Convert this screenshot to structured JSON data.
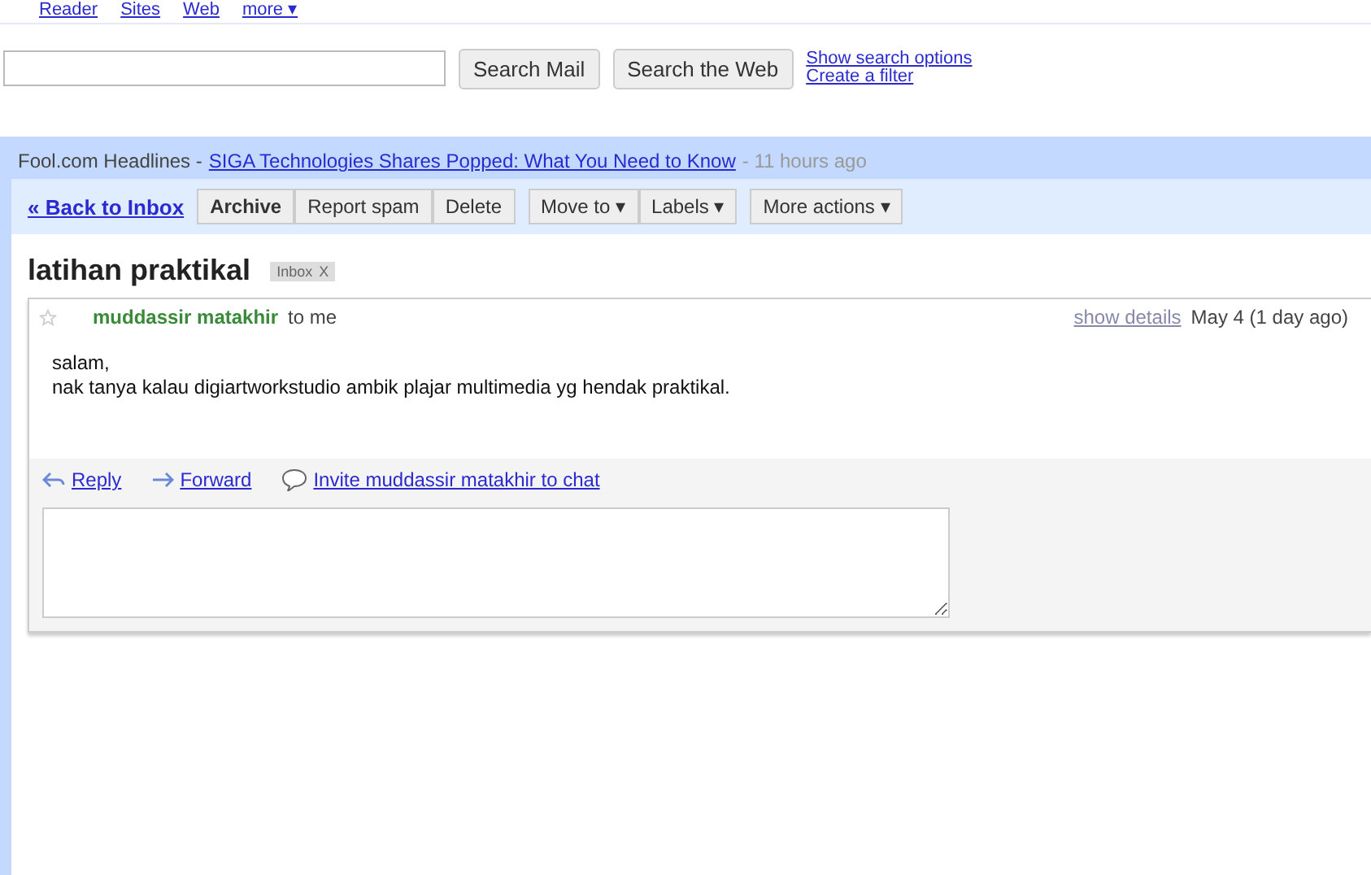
{
  "top_links": [
    "Reader",
    "Sites",
    "Web",
    "more ▾"
  ],
  "search": {
    "buttons": [
      "Search Mail",
      "Search the Web"
    ],
    "links": [
      "Show search options",
      "Create a filter"
    ]
  },
  "headline": {
    "source": "Fool.com Headlines - ",
    "link": "SIGA Technologies Shares Popped: What You Need to Know",
    "age": "- 11 hours ago"
  },
  "toolbar": {
    "back": "« Back to Inbox",
    "groups": [
      [
        "Archive",
        "Report spam",
        "Delete"
      ],
      [
        "Move to ▾",
        "Labels ▾"
      ],
      [
        "More actions ▾"
      ]
    ]
  },
  "subject": {
    "title": "latihan praktikal",
    "label": "Inbox",
    "label_close": "X"
  },
  "message": {
    "starred": false,
    "sender": "muddassir matakhir",
    "to": "to me",
    "details": "show details",
    "date": "May 4 (1 day ago)",
    "body": [
      "salam,",
      "nak tanya kalau digiartworkstudio ambik plajar multimedia yg hendak praktikal."
    ],
    "actions": [
      {
        "kind": "reply",
        "label": "Reply"
      },
      {
        "kind": "forward",
        "label": "Forward"
      },
      {
        "kind": "chat",
        "label": "Invite muddassir matakhir to chat"
      }
    ]
  }
}
